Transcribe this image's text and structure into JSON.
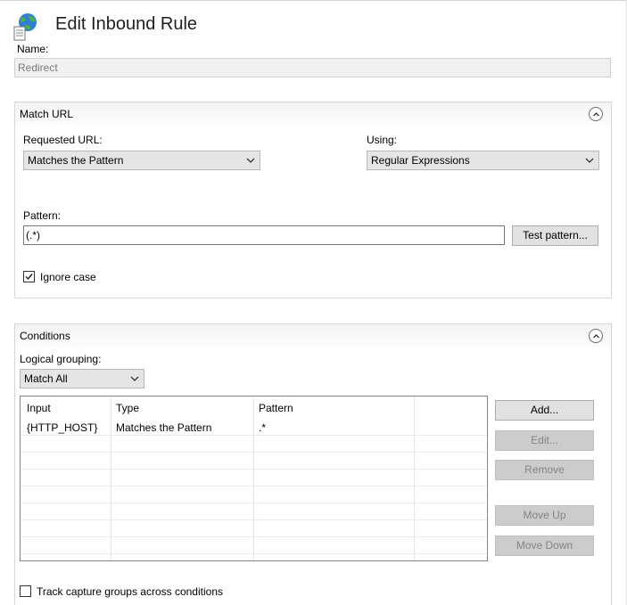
{
  "header": {
    "title": "Edit Inbound Rule",
    "icon": "globe-document-icon"
  },
  "name": {
    "label": "Name:",
    "value": "Redirect"
  },
  "match_url": {
    "title": "Match URL",
    "requested_url": {
      "label": "Requested URL:",
      "value": "Matches the Pattern"
    },
    "using": {
      "label": "Using:",
      "value": "Regular Expressions"
    },
    "pattern": {
      "label": "Pattern:",
      "value": "(.*)",
      "test_button": "Test pattern..."
    },
    "ignore_case": {
      "label": "Ignore case",
      "checked": true
    }
  },
  "conditions": {
    "title": "Conditions",
    "logical_grouping": {
      "label": "Logical grouping:",
      "value": "Match All"
    },
    "columns": [
      "Input",
      "Type",
      "Pattern"
    ],
    "rows": [
      {
        "input": "{HTTP_HOST}",
        "type": "Matches the Pattern",
        "pattern": ".*"
      }
    ],
    "buttons": {
      "add": "Add...",
      "edit": "Edit...",
      "remove": "Remove",
      "move_up": "Move Up",
      "move_down": "Move Down"
    },
    "track_capture": {
      "label": "Track capture groups across conditions",
      "checked": false
    }
  }
}
